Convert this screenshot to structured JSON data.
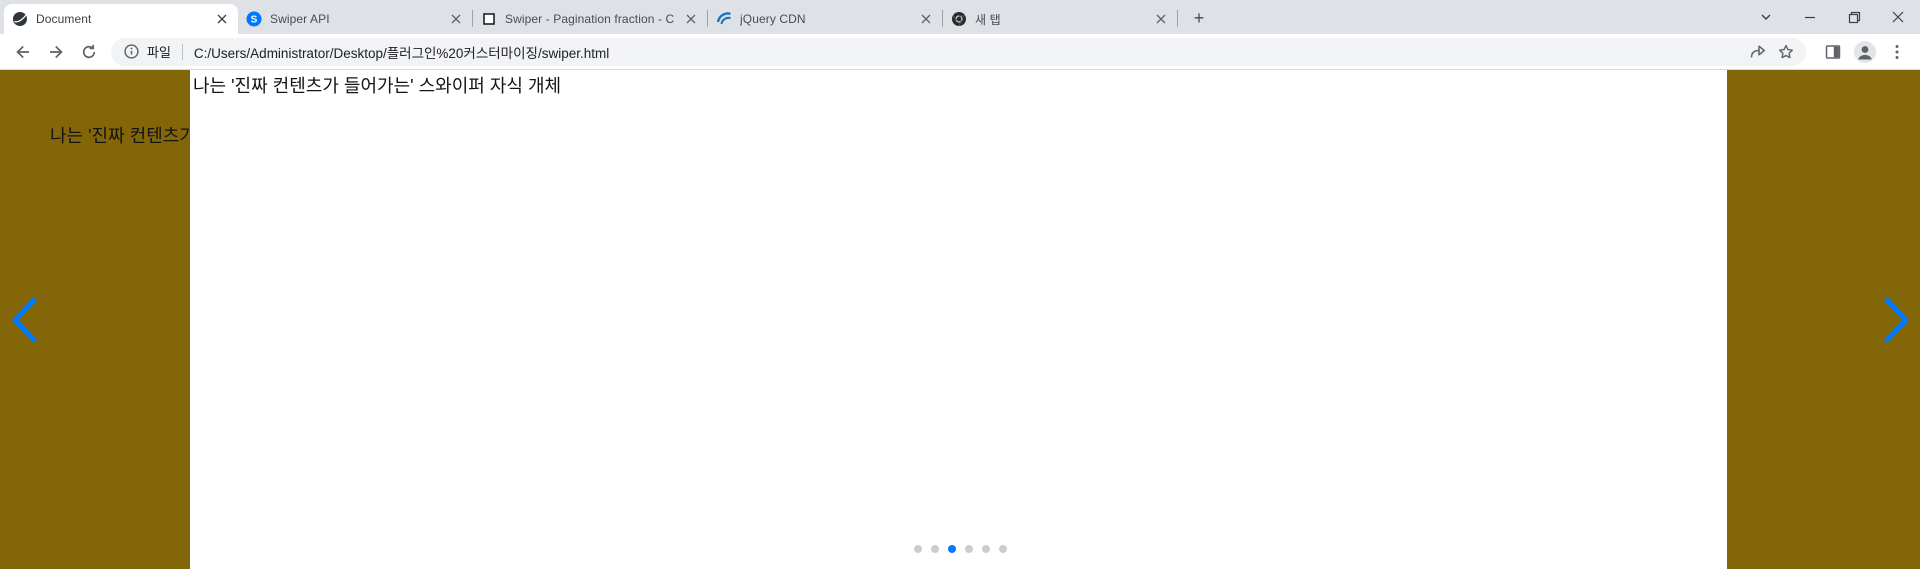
{
  "browser": {
    "tabs": [
      {
        "title": "Document",
        "icon": "globe-dark-icon"
      },
      {
        "title": "Swiper API",
        "icon": "swiper-logo-icon"
      },
      {
        "title": "Swiper - Pagination fraction - C",
        "icon": "square-outline-icon"
      },
      {
        "title": "jQuery CDN",
        "icon": "jquery-logo-icon"
      },
      {
        "title": "새 탭",
        "icon": "chrome-dark-icon"
      }
    ],
    "new_tab_label": "+",
    "address": {
      "scheme_label": "파일",
      "url": "C:/Users/Administrator/Desktop/플러그인%20커스터마이징/swiper.html"
    }
  },
  "swiper": {
    "active_slide_text": "나는 '진짜 컨텐츠가 들어가는' 스와이퍼 자식 개체",
    "prev_slide_visible_text": "나는 '진짜 컨텐츠가",
    "pagination": {
      "total": 6,
      "active_index": 2
    },
    "colors": {
      "slide_background": "#826608",
      "active_slide_background": "#ffffff",
      "accent_blue": "#007aff",
      "inactive_dot": "rgba(0,0,0,0.2)"
    }
  }
}
